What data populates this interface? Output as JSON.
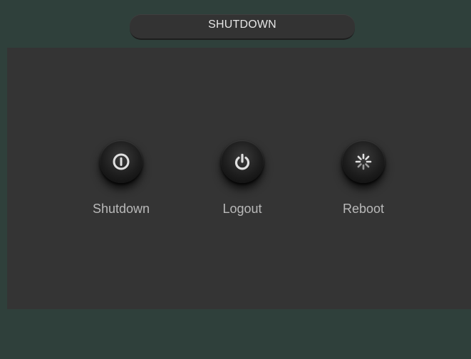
{
  "header": {
    "title": "SHUTDOWN"
  },
  "options": [
    {
      "label": "Shutdown",
      "icon": "shutdown-icon"
    },
    {
      "label": "Logout",
      "icon": "power-icon"
    },
    {
      "label": "Reboot",
      "icon": "reboot-icon"
    }
  ],
  "colors": {
    "frame": "#2f403b",
    "panel": "#343434",
    "title_pill": "#333333",
    "label_text": "#b9b9b9",
    "icon": "#e0e0e0"
  }
}
